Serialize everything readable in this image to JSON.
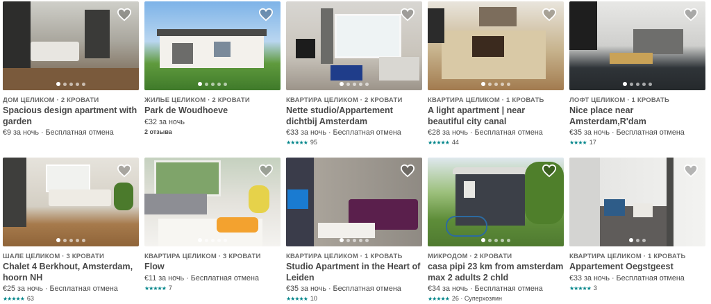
{
  "colors": {
    "accent": "#008489",
    "text": "#484848",
    "muted": "#6b6b6b"
  },
  "listings": [
    {
      "type": "ДОМ ЦЕЛИКОМ · 2 КРОВАТИ",
      "title": "Spacious design apartment with garden",
      "price": "€9 за ночь · Бесплатная отмена",
      "stars": "",
      "reviews": "",
      "extra": "",
      "stars_count": 0
    },
    {
      "type": "ЖИЛЬЕ ЦЕЛИКОМ · 2 КРОВАТИ",
      "title": "Park de Woudhoeve",
      "price": "€32 за ночь",
      "stars": "",
      "reviews": "2 отзыва",
      "extra": "",
      "stars_count": 0
    },
    {
      "type": "КВАРТИРА ЦЕЛИКОМ · 2 КРОВАТИ",
      "title": "Nette studio/Appartement dichtbij Amsterdam",
      "price": "€33 за ночь · Бесплатная отмена",
      "stars": "★★★★★",
      "reviews": "95",
      "extra": "",
      "stars_count": 5
    },
    {
      "type": "КВАРТИРА ЦЕЛИКОМ · 1 КРОВАТЬ",
      "title": "A light apartment | near beautiful city canal",
      "price": "€28 за ночь · Бесплатная отмена",
      "stars": "★★★★★",
      "reviews": "44",
      "extra": "",
      "stars_count": 5
    },
    {
      "type": "ЛОФТ ЦЕЛИКОМ · 1 КРОВАТЬ",
      "title": "Nice place near Amsterdam,R'dam",
      "price": "€35 за ночь · Бесплатная отмена",
      "stars": "★★★★",
      "reviews": "17",
      "extra": "",
      "stars_count": 4
    },
    {
      "type": "ШАЛЕ ЦЕЛИКОМ · 3 КРОВАТИ",
      "title": "Chalet 4 Berkhout, Amsterdam, hoorn NH",
      "price": "€25 за ночь · Бесплатная отмена",
      "stars": "★★★★★",
      "reviews": "63",
      "extra": "",
      "stars_count": 5
    },
    {
      "type": "КВАРТИРА ЦЕЛИКОМ · 3 КРОВАТИ",
      "title": "Flow",
      "price": "€11 за ночь · Бесплатная отмена",
      "stars": "★★★★★",
      "reviews": "7",
      "extra": "",
      "stars_count": 5
    },
    {
      "type": "КВАРТИРА ЦЕЛИКОМ · 1 КРОВАТЬ",
      "title": "Studio Apartment in the Heart of Leiden",
      "price": "€35 за ночь · Бесплатная отмена",
      "stars": "★★★★★",
      "reviews": "10",
      "extra": "",
      "stars_count": 5
    },
    {
      "type": "МИКРОДОМ · 2 КРОВАТИ",
      "title": "casa pipi 23 km from amsterdam max 2 adults 2 chld",
      "price": "€34 за ночь · Бесплатная отмена",
      "stars": "★★★★★",
      "reviews": "26",
      "extra": "· Суперхозяин",
      "stars_count": 5
    },
    {
      "type": "КВАРТИРА ЦЕЛИКОМ · 1 КРОВАТЬ",
      "title": "Appartement Oegstgeest",
      "price": "€33 за ночь · Бесплатная отмена",
      "stars": "★★★★★",
      "reviews": "3",
      "extra": "",
      "stars_count": 5
    }
  ]
}
